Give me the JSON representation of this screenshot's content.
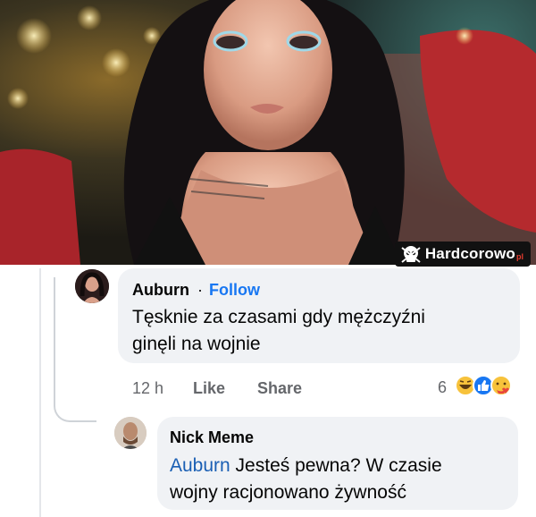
{
  "watermark": {
    "brand": "Hardcorowo",
    "tld": "pl"
  },
  "comment1": {
    "author": "Auburn",
    "separator": "·",
    "follow_label": "Follow",
    "text_line1": "Tęsknie za czasami gdy mężczyźni",
    "text_line2": "ginęli na wojnie",
    "time": "12 h",
    "like_label": "Like",
    "share_label": "Share",
    "reaction_count": "6",
    "reaction_icons": [
      "haha-icon",
      "like-icon",
      "care-icon"
    ]
  },
  "comment2": {
    "author": "Nick Meme",
    "mention": "Auburn",
    "text_line1_rest": " Jesteś pewna? W czasie",
    "text_line2": "wojny racjonowano żywność"
  }
}
